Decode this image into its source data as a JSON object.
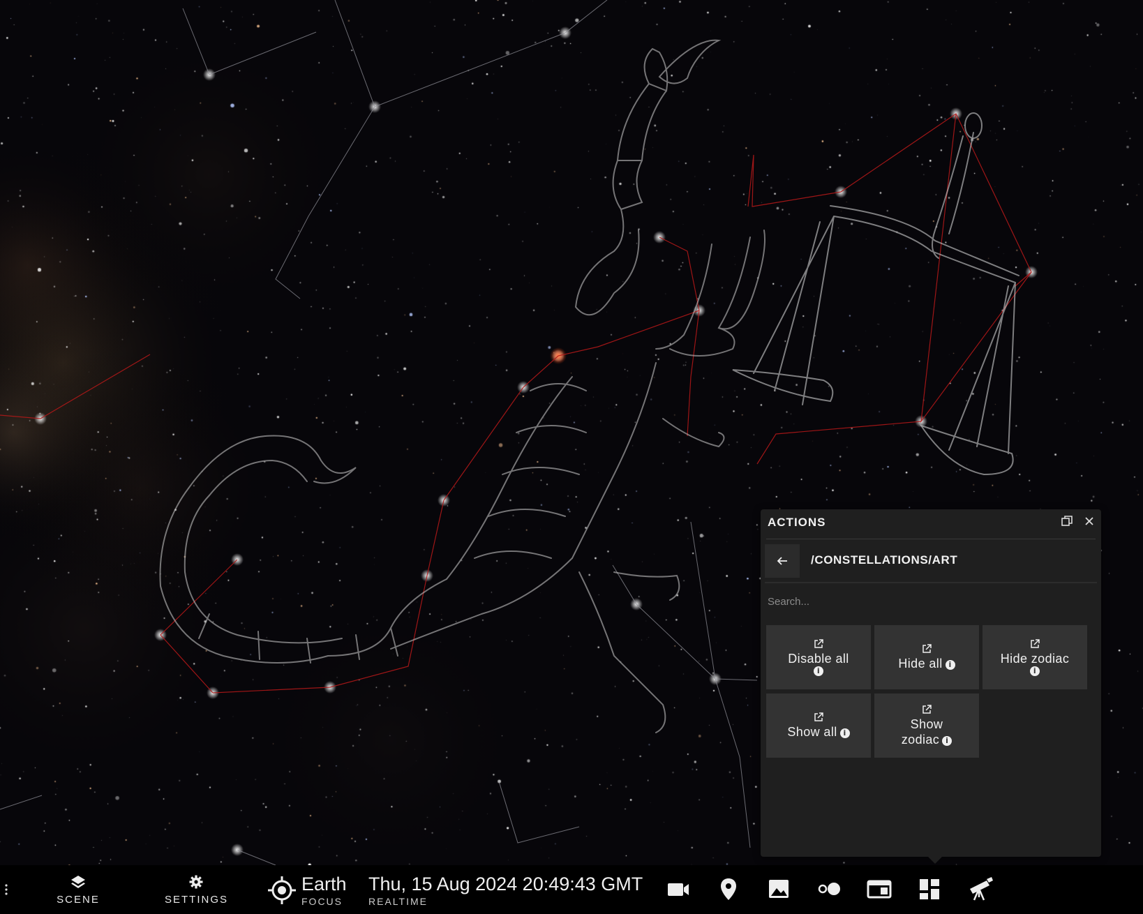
{
  "panel": {
    "title": "ACTIONS",
    "popout_icon": "popout-icon",
    "close_icon": "close-icon",
    "back_icon": "arrow-left-icon",
    "path": "/CONSTELLATIONS/ART",
    "search_placeholder": "Search...",
    "actions": [
      {
        "label": "Disable all",
        "icon": "external-link-icon",
        "info": "info-icon"
      },
      {
        "label": "Hide all",
        "icon": "external-link-icon",
        "info": "info-icon"
      },
      {
        "label": "Hide zodiac",
        "icon": "external-link-icon",
        "info": "info-icon"
      },
      {
        "label": "Show all",
        "icon": "external-link-icon",
        "info": "info-icon"
      },
      {
        "label": "Show zodiac",
        "icon": "external-link-icon",
        "info": "info-icon"
      }
    ]
  },
  "taskbar": {
    "menu_icon": "more-vertical-icon",
    "scene": {
      "label": "SCENE",
      "icon": "layers-icon"
    },
    "settings": {
      "label": "SETTINGS",
      "icon": "gear-icon"
    },
    "focus": {
      "name": "Earth",
      "sub": "FOCUS",
      "icon": "crosshair-icon"
    },
    "time": {
      "datetime": "Thu, 15 Aug 2024 20:49:43 GMT",
      "sub": "REALTIME"
    },
    "icons": [
      "video-camera-icon",
      "map-pin-icon",
      "image-icon",
      "toggle-dots-icon",
      "window-icon",
      "dashboard-icon",
      "telescope-icon"
    ]
  },
  "colors": {
    "sky": "#07060a",
    "constellation_line": "#b01818",
    "art_line": "#cfcfcf",
    "panel_bg": "#1f1f1f",
    "button_bg": "#333333",
    "taskbar_bg": "#000000"
  }
}
